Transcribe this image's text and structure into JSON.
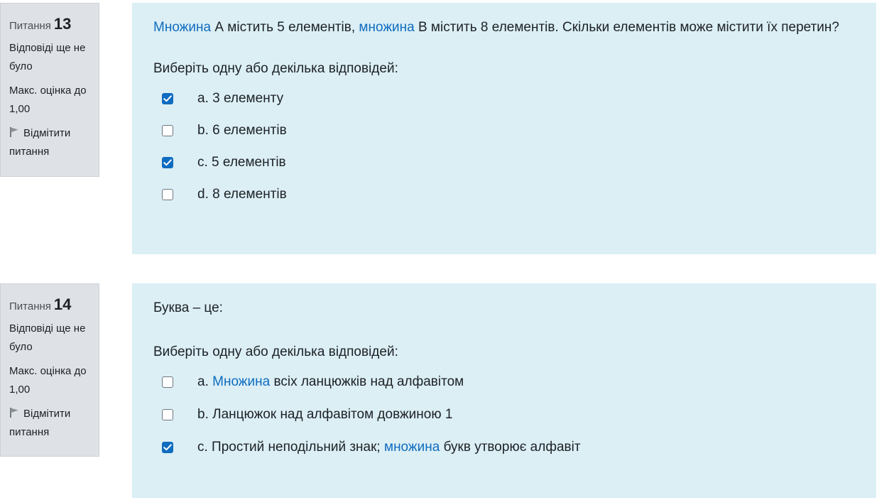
{
  "questions": [
    {
      "label": "Питання",
      "number": "13",
      "state": "Відповіді ще не було",
      "grade": "Макс. оцінка до 1,00",
      "flag_label": "Відмітити питання",
      "text_parts": [
        {
          "text": "Множина",
          "link": true
        },
        {
          "text": " А містить 5 елементів, ",
          "link": false
        },
        {
          "text": "множина",
          "link": true
        },
        {
          "text": " В містить 8 елементів. Скільки елементів може містити їх перетин?",
          "link": false
        }
      ],
      "prompt": "Виберіть одну або декілька відповідей:",
      "answers": [
        {
          "parts": [
            {
              "text": "a. 3 елементу",
              "link": false
            }
          ],
          "checked": true
        },
        {
          "parts": [
            {
              "text": "b. 6 елементів",
              "link": false
            }
          ],
          "checked": false
        },
        {
          "parts": [
            {
              "text": "c. 5 елементів",
              "link": false
            }
          ],
          "checked": true
        },
        {
          "parts": [
            {
              "text": "d. 8 елементів",
              "link": false
            }
          ],
          "checked": false
        }
      ]
    },
    {
      "label": "Питання",
      "number": "14",
      "state": "Відповіді ще не було",
      "grade": "Макс. оцінка до 1,00",
      "flag_label": "Відмітити питання",
      "text_parts": [
        {
          "text": "Буква – це:",
          "link": false
        }
      ],
      "prompt": "Виберіть одну або декілька відповідей:",
      "answers": [
        {
          "parts": [
            {
              "text": "a. ",
              "link": false
            },
            {
              "text": "Множина",
              "link": true
            },
            {
              "text": " всіх ланцюжків над алфавітом",
              "link": false
            }
          ],
          "checked": false
        },
        {
          "parts": [
            {
              "text": "b. Ланцюжок над алфавітом довжиною 1",
              "link": false
            }
          ],
          "checked": false
        },
        {
          "parts": [
            {
              "text": "c. Простий неподільний знак; ",
              "link": false
            },
            {
              "text": "множина",
              "link": true
            },
            {
              "text": " букв утворює алфавіт",
              "link": false
            }
          ],
          "checked": true
        }
      ]
    }
  ],
  "colors": {
    "link": "#0f6cbf",
    "content_bg": "#dbeff5",
    "info_bg": "#dee2e6",
    "checkbox_checked": "#0f6cbf"
  },
  "icons": {
    "flag": "flag-icon",
    "check": "checkmark-icon"
  }
}
